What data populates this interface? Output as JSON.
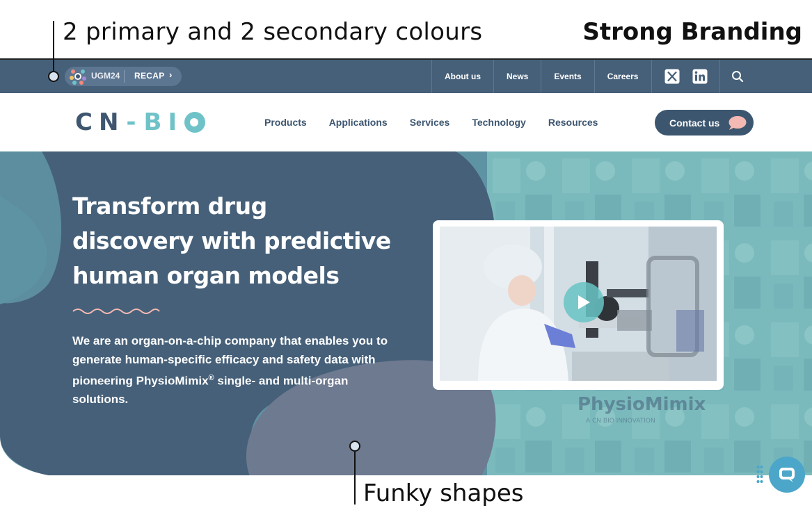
{
  "annotations": {
    "top_left": "2 primary and 2 secondary colours",
    "top_right": "Strong Branding",
    "bottom": "Funky shapes"
  },
  "utility_bar": {
    "promo_event": "UGM24",
    "promo_action": "RECAP",
    "links": [
      "About us",
      "News",
      "Events",
      "Careers"
    ],
    "social": [
      "x-icon",
      "linkedin-icon"
    ],
    "search_icon": "search-icon"
  },
  "header": {
    "logo": "CN-BIO",
    "nav": [
      "Products",
      "Applications",
      "Services",
      "Technology",
      "Resources"
    ],
    "contact_label": "Contact us"
  },
  "hero": {
    "title_lines": [
      "Transform drug",
      "discovery with predictive",
      "human organ models"
    ],
    "body_pre": "We are an organ-on-a-chip company that enables you to generate human-specific efficacy and safety data with pioneering PhysioMimix",
    "body_sup": "®",
    "body_post": " single- and multi-organ solutions.",
    "video_play_icon": "play-icon",
    "background_text_1": "PhysioMimix",
    "background_text_2": "A CN BIO INNOVATION"
  },
  "colors": {
    "primary_navy": "#3d5670",
    "primary_teal": "#6fc3c8",
    "secondary_slate": "#6e7a90",
    "secondary_pink": "#f4b9b2",
    "utility_bar": "#466079"
  }
}
